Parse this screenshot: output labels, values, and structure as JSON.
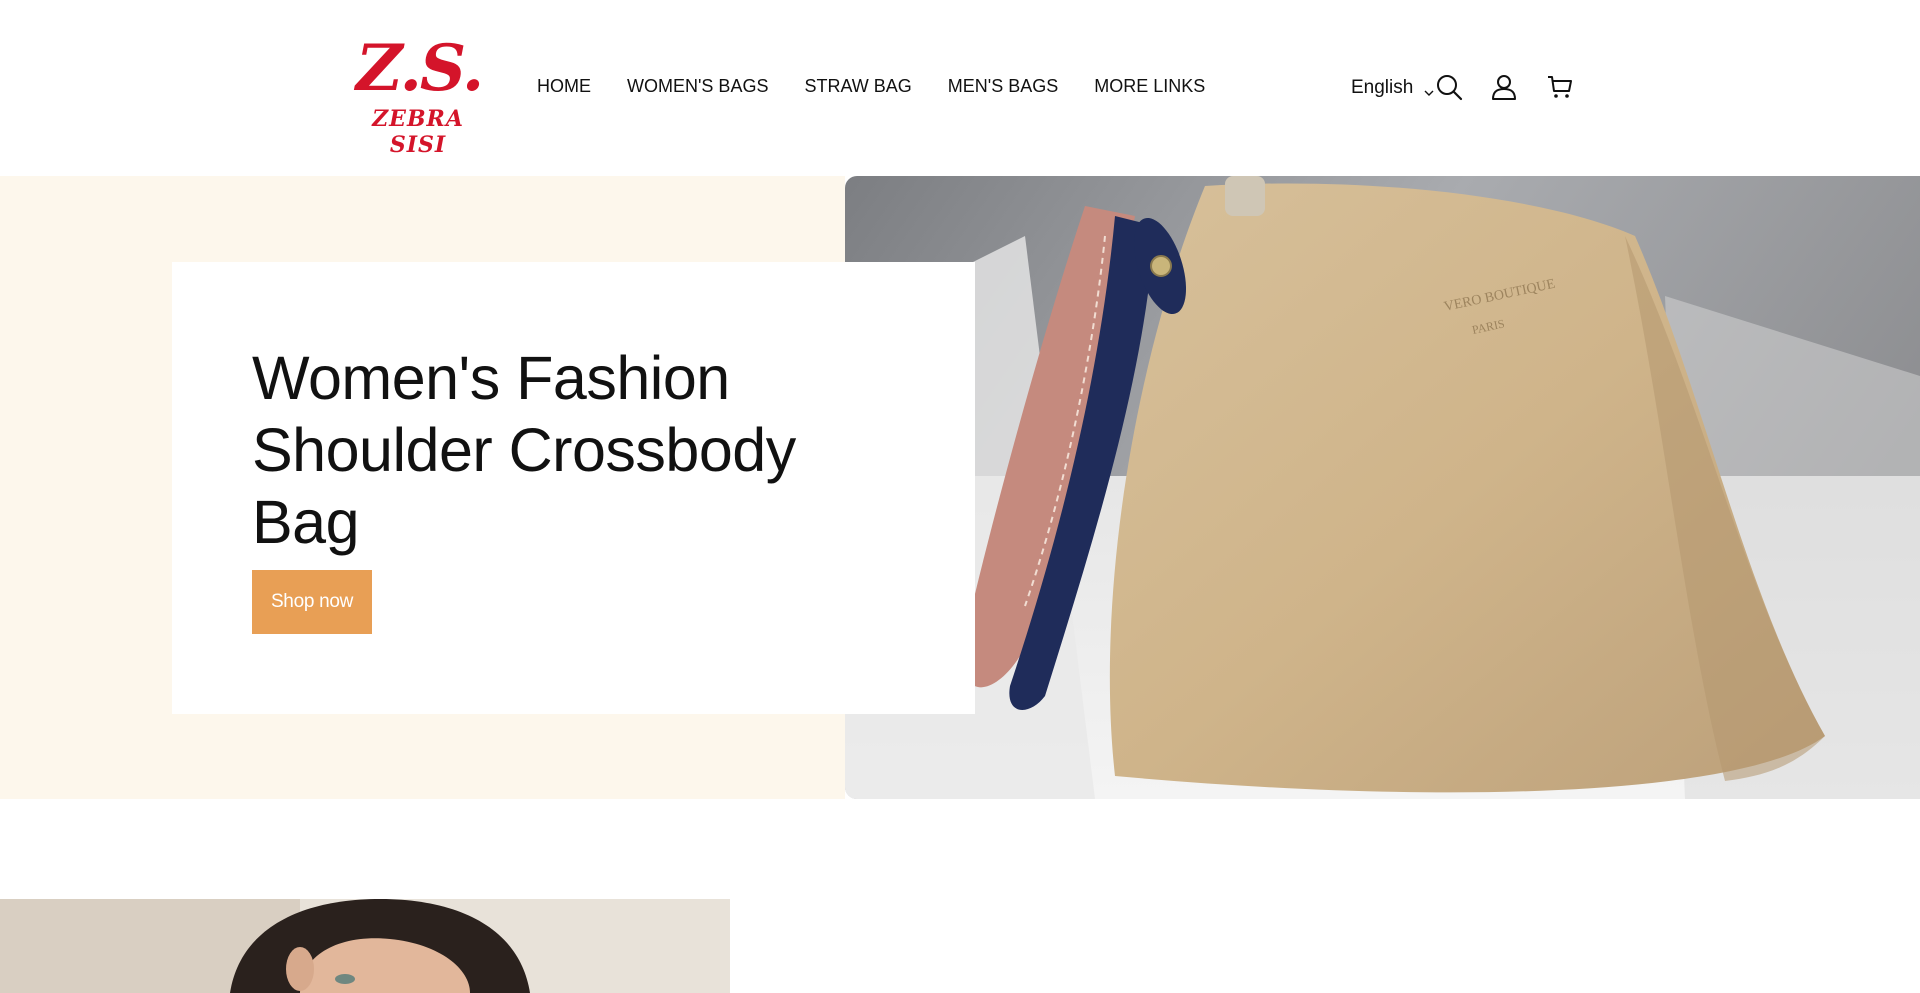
{
  "brand": {
    "logo_mark": "Z.S.",
    "logo_name": "ZEBRA SISI",
    "color": "#d4142a"
  },
  "nav": {
    "items": [
      {
        "label": "HOME"
      },
      {
        "label": "WOMEN'S BAGS"
      },
      {
        "label": "STRAW BAG"
      },
      {
        "label": "MEN'S BAGS"
      },
      {
        "label": "MORE LINKS"
      }
    ]
  },
  "header_tools": {
    "language": "English",
    "icons": [
      "search-icon",
      "account-icon",
      "cart-icon"
    ]
  },
  "hero": {
    "title": "Women's Fashion Shoulder Crossbody Bag",
    "cta_label": "Shop now",
    "cta_color": "#e89f55",
    "background_color": "#fdf7ec",
    "image_text_line1": "VERO BOUTIQUE",
    "image_text_line2": "PARIS"
  }
}
